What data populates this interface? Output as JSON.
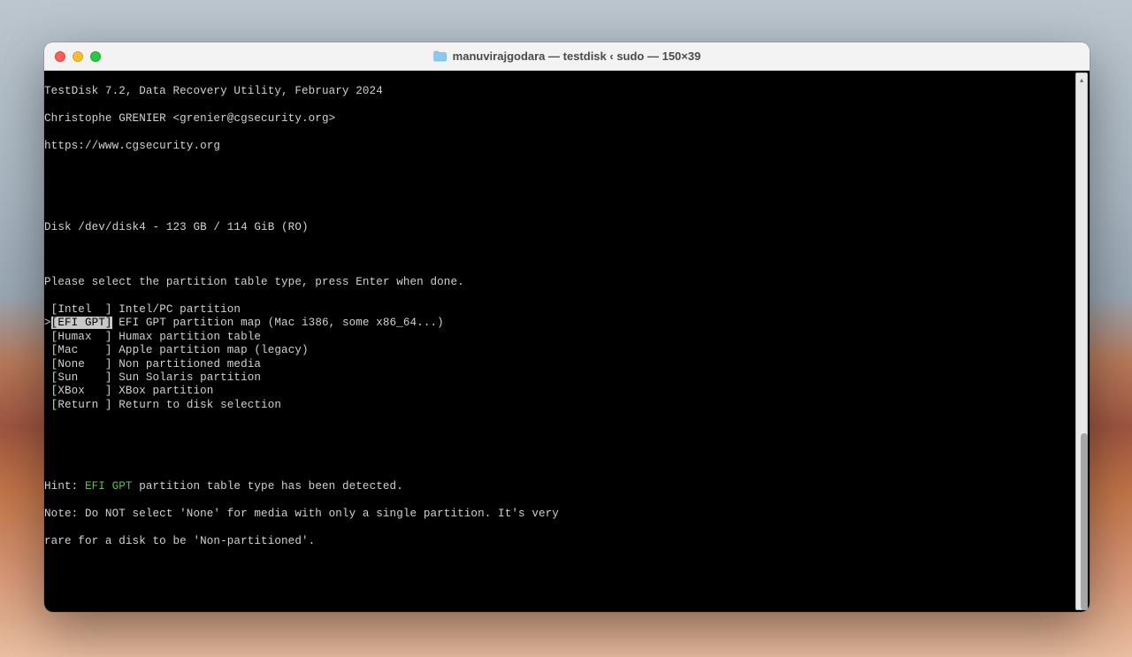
{
  "window": {
    "title": "manuvirajgodara — testdisk ‹ sudo — 150×39"
  },
  "terminal": {
    "header": {
      "line1": "TestDisk 7.2, Data Recovery Utility, February 2024",
      "line2": "Christophe GRENIER <grenier@cgsecurity.org>",
      "line3": "https://www.cgsecurity.org"
    },
    "disk": "Disk /dev/disk4 - 123 GB / 114 GiB (RO)",
    "prompt": "Please select the partition table type, press Enter when done.",
    "options": [
      {
        "prefix": " ",
        "label": "[Intel  ]",
        "desc": " Intel/PC partition",
        "selected": false
      },
      {
        "prefix": ">",
        "label": "[EFI GPT]",
        "desc": " EFI GPT partition map (Mac i386, some x86_64...)",
        "selected": true
      },
      {
        "prefix": " ",
        "label": "[Humax  ]",
        "desc": " Humax partition table",
        "selected": false
      },
      {
        "prefix": " ",
        "label": "[Mac    ]",
        "desc": " Apple partition map (legacy)",
        "selected": false
      },
      {
        "prefix": " ",
        "label": "[None   ]",
        "desc": " Non partitioned media",
        "selected": false
      },
      {
        "prefix": " ",
        "label": "[Sun    ]",
        "desc": " Sun Solaris partition",
        "selected": false
      },
      {
        "prefix": " ",
        "label": "[XBox   ]",
        "desc": " XBox partition",
        "selected": false
      },
      {
        "prefix": " ",
        "label": "[Return ]",
        "desc": " Return to disk selection",
        "selected": false
      }
    ],
    "hint": {
      "prefix": "Hint: ",
      "highlight": "EFI GPT",
      "suffix": " partition table type has been detected."
    },
    "note": {
      "line1": "Note: Do NOT select 'None' for media with only a single partition. It's very",
      "line2": "rare for a disk to be 'Non-partitioned'."
    }
  }
}
